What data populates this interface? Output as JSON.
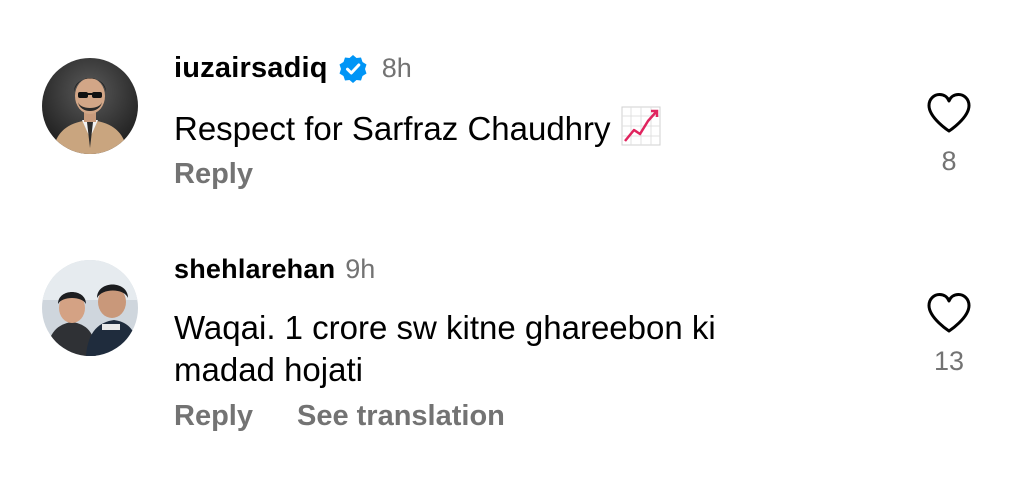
{
  "comments": [
    {
      "username": "iuzairsadiq",
      "verified": true,
      "time": "8h",
      "text": "Respect for Sarfraz Chaudhry",
      "emoji": "chart-increasing-icon",
      "reply_label": "Reply",
      "like_count": "8",
      "avatar": "avatar-man-in-suit"
    },
    {
      "username": "shehlarehan",
      "verified": false,
      "time": "9h",
      "text_line1": "Waqai. 1 crore sw kitne ghareebon ki",
      "text_line2": "madad hojati",
      "reply_label": "Reply",
      "translate_label": "See translation",
      "like_count": "13",
      "avatar": "avatar-two-people-snow"
    }
  ],
  "colors": {
    "text": "#000000",
    "muted": "#737373",
    "verified_blue": "#0095F6",
    "chart_red": "#E0245E"
  }
}
